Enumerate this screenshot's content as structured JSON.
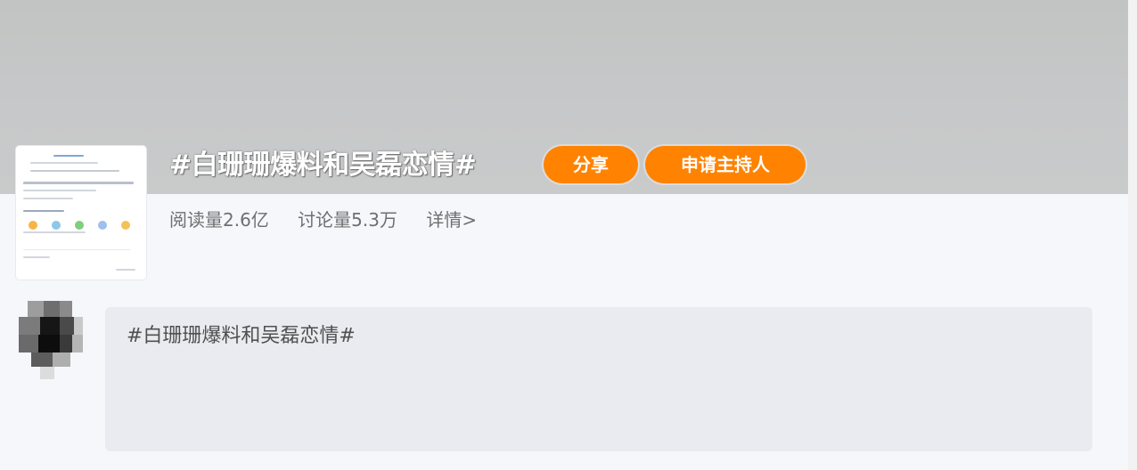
{
  "topic": {
    "title": "#白珊珊爆料和吴磊恋情#",
    "share_label": "分享",
    "host_label": "申请主持人",
    "reads": "阅读量2.6亿",
    "discussions": "讨论量5.3万",
    "details_link": "详情>"
  },
  "composer": {
    "text": "#白珊珊爆料和吴磊恋情#"
  },
  "colors": {
    "accent": "#ff8200",
    "banner": "#c7c8c9",
    "composer_bg": "#e9ebf0"
  }
}
